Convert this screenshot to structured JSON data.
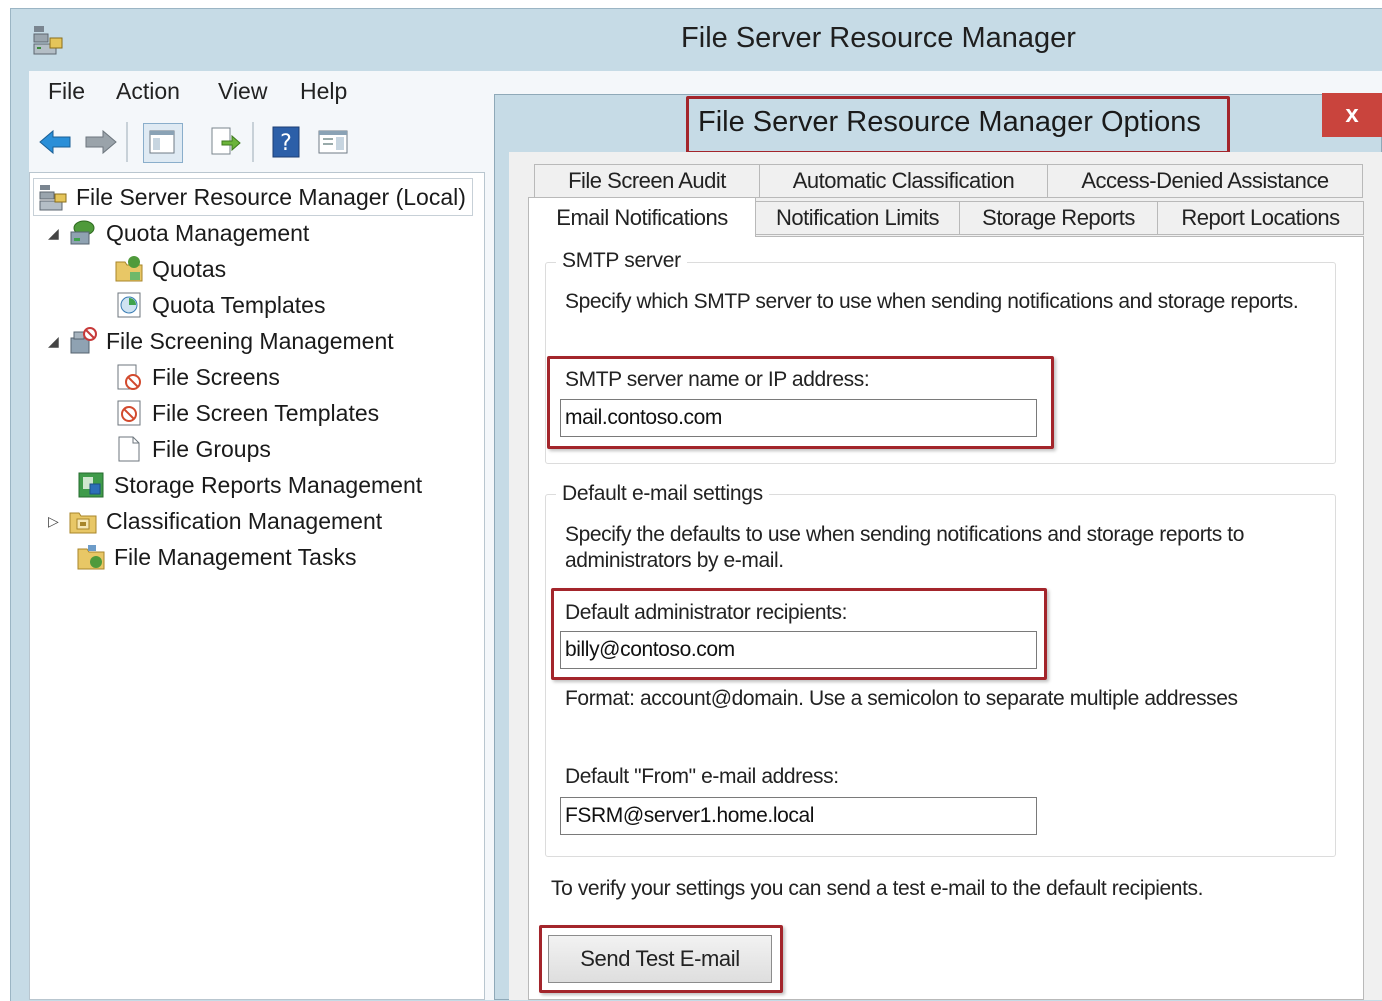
{
  "main_window": {
    "title": "File Server Resource Manager",
    "menu": [
      "File",
      "Action",
      "View",
      "Help"
    ],
    "toolbar_icons": [
      "back-arrow-icon",
      "forward-arrow-icon",
      "show-hide-console-tree-icon",
      "export-list-icon",
      "help-icon",
      "action-pane-icon"
    ]
  },
  "tree": {
    "root": "File Server Resource Manager (Local)",
    "items": [
      {
        "label": "Quota Management",
        "icon": "quota-management-icon",
        "expander": "◢"
      },
      {
        "label": "Quotas",
        "icon": "quotas-folder-icon"
      },
      {
        "label": "Quota Templates",
        "icon": "quota-templates-icon"
      },
      {
        "label": "File Screening Management",
        "icon": "file-screening-icon",
        "expander": "◢"
      },
      {
        "label": "File Screens",
        "icon": "file-screens-icon"
      },
      {
        "label": "File Screen Templates",
        "icon": "file-screen-templates-icon"
      },
      {
        "label": "File Groups",
        "icon": "file-groups-icon"
      },
      {
        "label": "Storage Reports Management",
        "icon": "storage-reports-icon"
      },
      {
        "label": "Classification Management",
        "icon": "classification-icon",
        "expander": "▷"
      },
      {
        "label": "File Management Tasks",
        "icon": "file-management-tasks-icon"
      }
    ]
  },
  "dialog": {
    "title": "File Server Resource Manager Options",
    "close_label": "x",
    "tabs_row1": [
      "File Screen Audit",
      "Automatic Classification",
      "Access-Denied Assistance"
    ],
    "tabs_row2": [
      "Email Notifications",
      "Notification Limits",
      "Storage Reports",
      "Report Locations"
    ],
    "smtp": {
      "group_label": "SMTP server",
      "description": "Specify which SMTP server to use when sending notifications and storage reports.",
      "field_label": "SMTP server name or IP address:",
      "value": "mail.contoso.com"
    },
    "defaults": {
      "group_label": "Default e-mail settings",
      "description": "Specify the defaults to use when sending notifications and storage reports to administrators by e-mail.",
      "recipients_label": "Default administrator recipients:",
      "recipients_value": "billy@contoso.com",
      "format_hint": "Format: account@domain. Use a semicolon to separate multiple addresses",
      "from_label": "Default \"From\" e-mail address:",
      "from_value": "FSRM@server1.home.local"
    },
    "verify_text": "To verify your settings you can send a test e-mail to the default recipients.",
    "send_test_button": "Send Test E-mail"
  },
  "colors": {
    "highlight_red": "#a3252b",
    "chrome_blue": "#c6dbe6",
    "close_red": "#c9443d"
  }
}
